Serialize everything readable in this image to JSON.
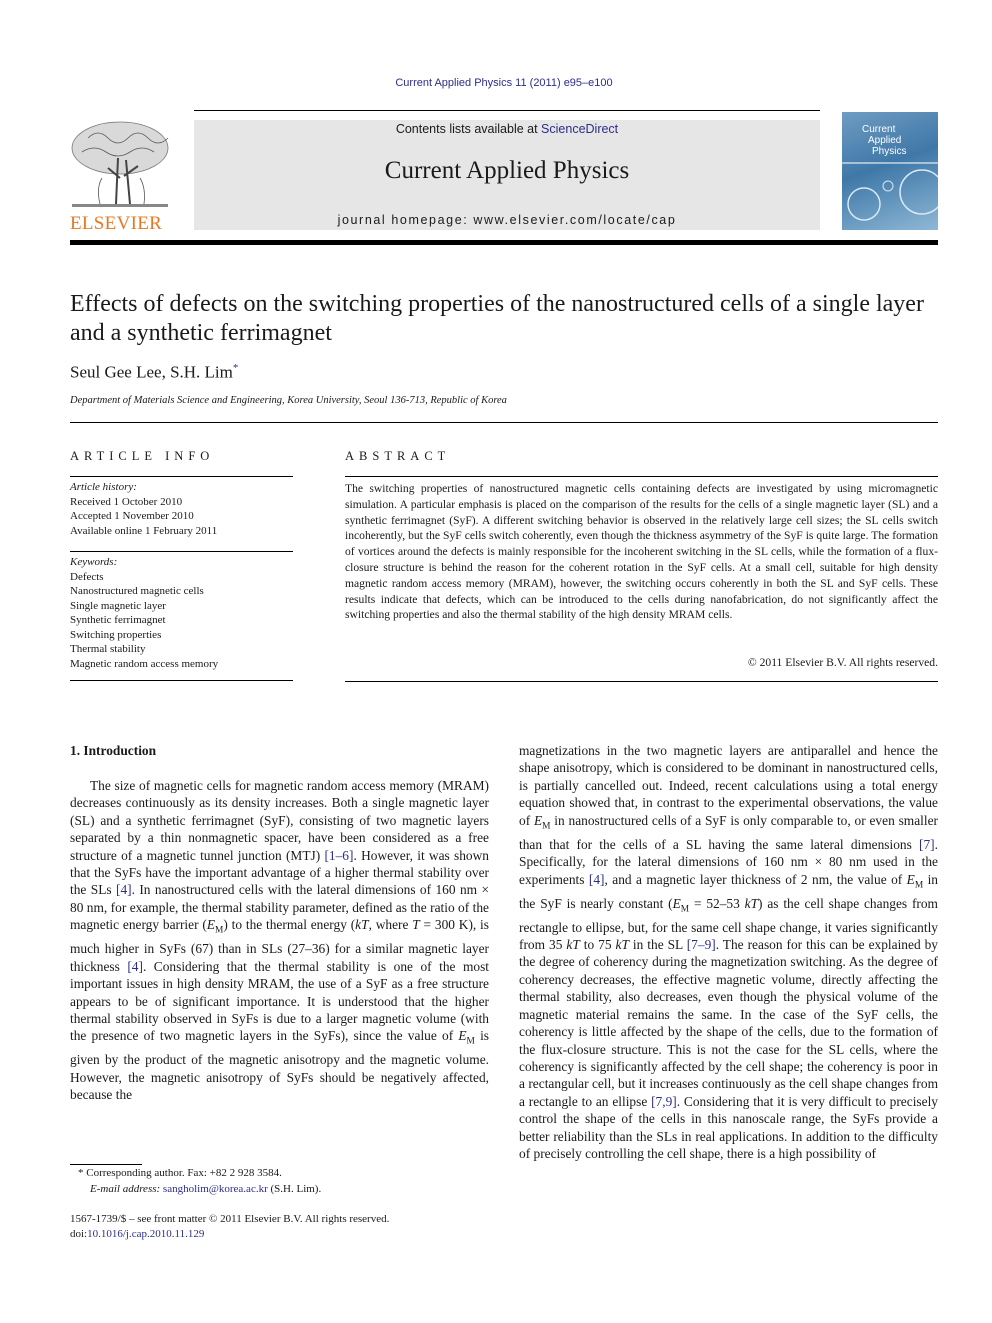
{
  "header": {
    "running_head": "Current Applied Physics 11 (2011) e95–e100",
    "publisher_logo": "ELSEVIER",
    "contents_prefix": "Contents lists available at ",
    "contents_link": "ScienceDirect",
    "journal_title": "Current Applied Physics",
    "homepage_prefix": "journal homepage: ",
    "homepage_url": "www.elsevier.com/locate/cap",
    "cover": {
      "line1": "Current",
      "line2": "Applied",
      "line3": "Physics"
    },
    "colors": {
      "elsevier_orange": "#e87722",
      "link_blue": "#2b2e8a",
      "banner_gray": "#e6e6e6"
    }
  },
  "article": {
    "title": "Effects of defects on the switching properties of the nanostructured cells of a single layer and a synthetic ferrimagnet",
    "authors": "Seul Gee Lee, S.H. Lim",
    "author_mark": "*",
    "affiliation": "Department of Materials Science and Engineering, Korea University, Seoul 136-713, Republic of Korea"
  },
  "article_info": {
    "heading": "ARTICLE INFO",
    "history_label": "Article history:",
    "history": [
      "Received 1 October 2010",
      "Accepted 1 November 2010",
      "Available online 1 February 2011"
    ],
    "keywords_label": "Keywords:",
    "keywords": [
      "Defects",
      "Nanostructured magnetic cells",
      "Single magnetic layer",
      "Synthetic ferrimagnet",
      "Switching properties",
      "Thermal stability",
      "Magnetic random access memory"
    ]
  },
  "abstract": {
    "heading": "ABSTRACT",
    "text": "The switching properties of nanostructured magnetic cells containing defects are investigated by using micromagnetic simulation. A particular emphasis is placed on the comparison of the results for the cells of a single magnetic layer (SL) and a synthetic ferrimagnet (SyF). A different switching behavior is observed in the relatively large cell sizes; the SL cells switch incoherently, but the SyF cells switch coherently, even though the thickness asymmetry of the SyF is quite large. The formation of vortices around the defects is mainly responsible for the incoherent switching in the SL cells, while the formation of a flux-closure structure is behind the reason for the coherent rotation in the SyF cells. At a small cell, suitable for high density magnetic random access memory (MRAM), however, the switching occurs coherently in both the SL and SyF cells. These results indicate that defects, which can be introduced to the cells during nanofabrication, do not significantly affect the switching properties and also the thermal stability of the high density MRAM cells.",
    "copyright": "© 2011 Elsevier B.V. All rights reserved."
  },
  "body": {
    "section_heading": "1.  Introduction",
    "col1": [
      {
        "t": "The size of magnetic cells for magnetic random access memory (MRAM) decreases continuously as its density increases. Both a single magnetic layer (SL) and a synthetic ferrimagnet (SyF), consisting of two magnetic layers separated by a thin nonmagnetic spacer, have been considered as a free structure of a magnetic tunnel junction (MTJ) "
      },
      {
        "ref": "[1–6]"
      },
      {
        "t": ". However, it was shown that the SyFs have the important advantage of a higher thermal stability over the SLs "
      },
      {
        "ref": "[4]"
      },
      {
        "t": ". In nanostructured cells with the lateral dimensions of 160 nm × 80 nm, for example, the thermal stability parameter, defined as the ratio of the magnetic energy barrier ("
      },
      {
        "em": "E",
        "sub": "M"
      },
      {
        "t": ") to the thermal energy ("
      },
      {
        "i": "kT"
      },
      {
        "t": ", where "
      },
      {
        "i": "T"
      },
      {
        "t": " = 300 K), is much higher in SyFs (67) than in SLs (27–36) for a similar magnetic layer thickness "
      },
      {
        "ref": "[4]"
      },
      {
        "t": ". Considering that the thermal stability is one of the most important issues in high density MRAM, the use of a SyF as a free structure appears to be of significant importance. It is understood that the higher thermal stability observed in SyFs is due to a larger magnetic volume (with the presence of two magnetic layers in the SyFs), since the value of "
      },
      {
        "em": "E",
        "sub": "M"
      },
      {
        "t": " is given by the product of the magnetic anisotropy and the magnetic volume. However, the magnetic anisotropy of SyFs should be negatively affected, because the"
      }
    ],
    "col2": [
      {
        "t": "magnetizations in the two magnetic layers are antiparallel and hence the shape anisotropy, which is considered to be dominant in nanostructured cells, is partially cancelled out. Indeed, recent calculations using a total energy equation showed that, in contrast to the experimental observations, the value of "
      },
      {
        "em": "E",
        "sub": "M"
      },
      {
        "t": " in nanostructured cells of a SyF is only comparable to, or even smaller than that for the cells of a SL having the same lateral dimensions "
      },
      {
        "ref": "[7]"
      },
      {
        "t": ". Specifically, for the lateral dimensions of 160 nm × 80 nm used in the experiments "
      },
      {
        "ref": "[4]"
      },
      {
        "t": ", and a magnetic layer thickness of 2 nm, the value of "
      },
      {
        "em": "E",
        "sub": "M"
      },
      {
        "t": " in the SyF is nearly constant ("
      },
      {
        "em": "E",
        "sub": "M"
      },
      {
        "t": " = 52–53 "
      },
      {
        "i": "kT"
      },
      {
        "t": ") as the cell shape changes from rectangle to ellipse, but, for the same cell shape change, it varies significantly from 35 "
      },
      {
        "i": "kT"
      },
      {
        "t": " to 75 "
      },
      {
        "i": "kT"
      },
      {
        "t": " in the SL "
      },
      {
        "ref": "[7–9]"
      },
      {
        "t": ". The reason for this can be explained by the degree of coherency during the magnetization switching. As the degree of coherency decreases, the effective magnetic volume, directly affecting the thermal stability, also decreases, even though the physical volume of the magnetic material remains the same. In the case of the SyF cells, the coherency is little affected by the shape of the cells, due to the formation of the flux-closure structure. This is not the case for the SL cells, where the coherency is significantly affected by the cell shape; the coherency is poor in a rectangular cell, but it increases continuously as the cell shape changes from a rectangle to an ellipse "
      },
      {
        "ref": "[7,9]"
      },
      {
        "t": ". Considering that it is very difficult to precisely control the shape of the cells in this nanoscale range, the SyFs provide a better reliability than the SLs in real applications. In addition to the difficulty of precisely controlling the cell shape, there is a high possibility of"
      }
    ]
  },
  "footnote": {
    "mark": "*",
    "corresponding": "Corresponding author. Fax: +82 2 928 3584.",
    "email_label": "E-mail address:",
    "email": "sangholim@korea.ac.kr",
    "email_suffix": "(S.H. Lim)."
  },
  "front_matter": {
    "issn_line": "1567-1739/$ – see front matter © 2011 Elsevier B.V. All rights reserved.",
    "doi_label": "doi:",
    "doi": "10.1016/j.cap.2010.11.129"
  }
}
